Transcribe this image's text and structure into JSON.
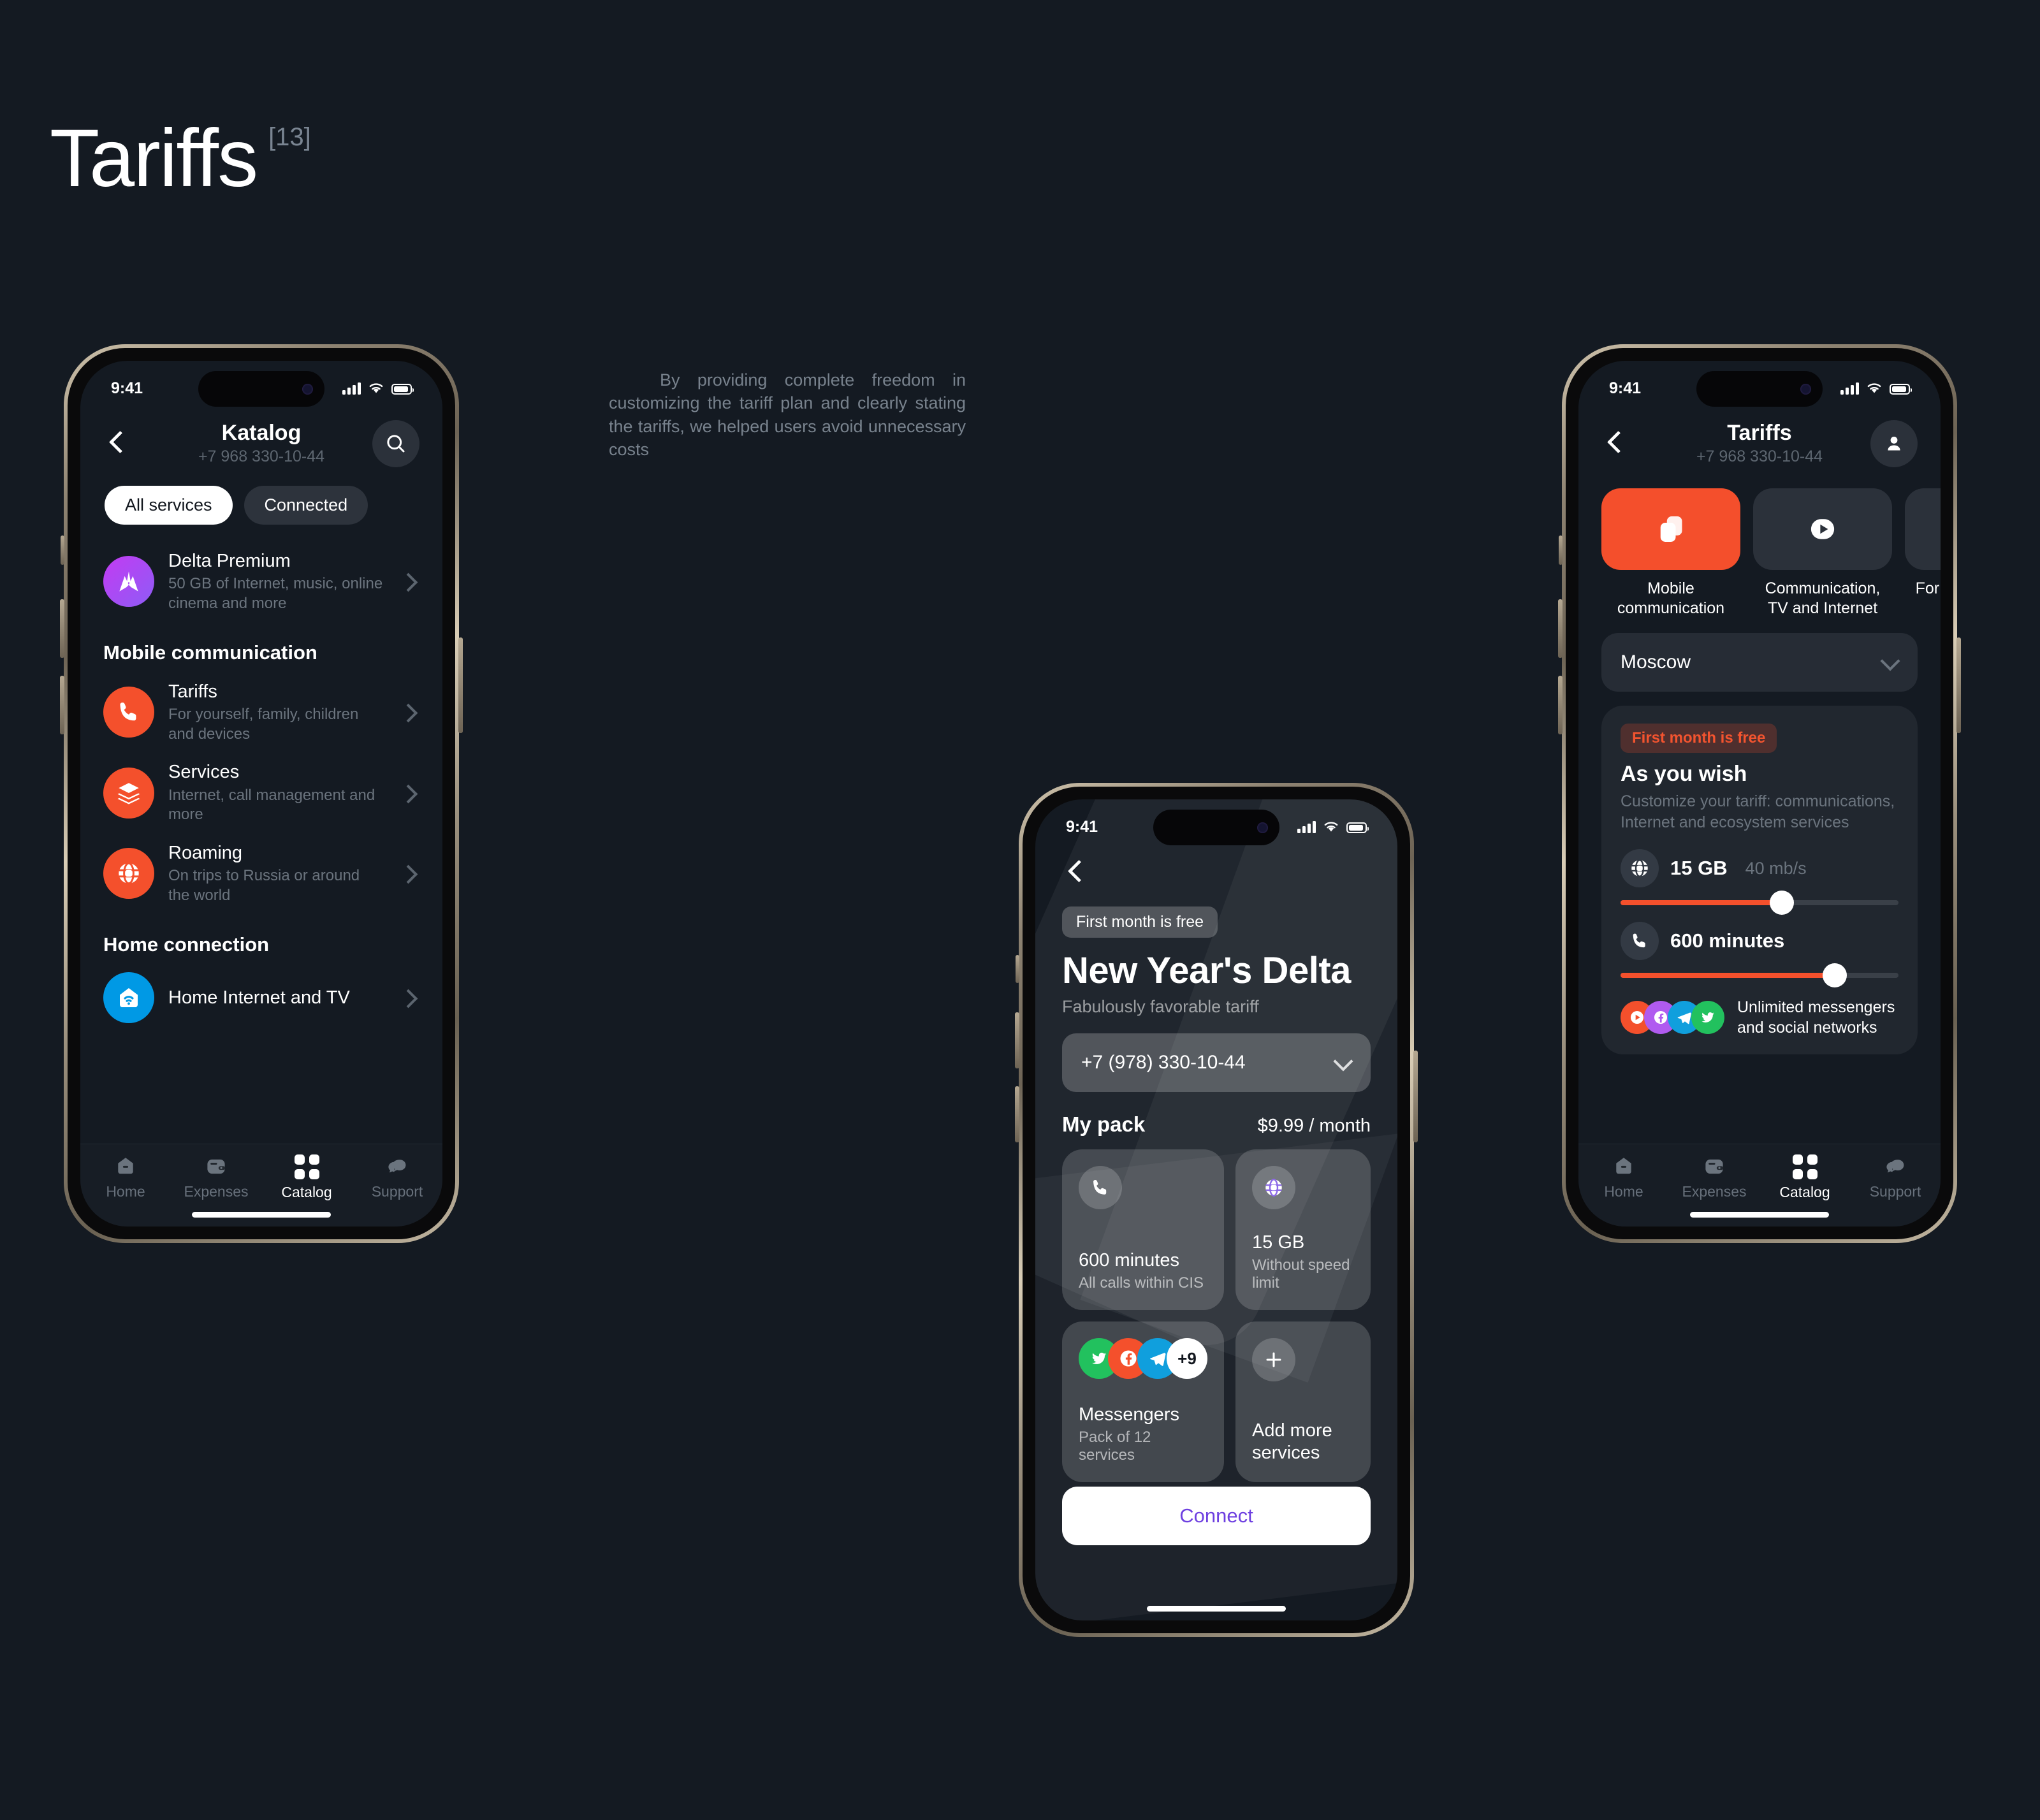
{
  "page": {
    "title": "Tariffs",
    "index": "[13]",
    "intro": "By providing complete freedom in customizing the tariff plan and clearly stating the tariffs, we helped users avoid unnecessary costs",
    "bg_color": "#141a22",
    "accent_orange": "#F4502C",
    "accent_purple": "#7945E0"
  },
  "phone_catalog": {
    "status": {
      "time": "9:41"
    },
    "nav": {
      "title": "Katalog",
      "subtitle": "+7 968 330-10-44",
      "back_icon": "chevron-left-icon",
      "action_icon": "search-icon"
    },
    "chips": [
      {
        "label": "All services",
        "selected": true
      },
      {
        "label": "Connected",
        "selected": false
      }
    ],
    "featured": {
      "title": "Delta Premium",
      "subtitle": "50 GB of Internet, music, online cinema and more",
      "icon": "delta-logo-icon",
      "icon_color": "#B83CF0"
    },
    "sections": [
      {
        "heading": "Mobile communication",
        "items": [
          {
            "title": "Tariffs",
            "subtitle": "For yourself, family, children and devices",
            "icon": "phone-icon",
            "icon_color": "#F4502C"
          },
          {
            "title": "Services",
            "subtitle": "Internet, call management and more",
            "icon": "layers-icon",
            "icon_color": "#F4502C"
          },
          {
            "title": "Roaming",
            "subtitle": "On trips to Russia or around the world",
            "icon": "globe-icon",
            "icon_color": "#F4502C"
          }
        ]
      },
      {
        "heading": "Home connection",
        "items": [
          {
            "title": "Home Internet and TV",
            "subtitle": "",
            "icon": "home-wifi-icon",
            "icon_color": "#0099E5"
          }
        ]
      }
    ],
    "tabs": [
      {
        "label": "Home",
        "icon": "home-icon",
        "active": false
      },
      {
        "label": "Expenses",
        "icon": "wallet-icon",
        "active": false
      },
      {
        "label": "Catalog",
        "icon": "grid-icon",
        "active": true
      },
      {
        "label": "Support",
        "icon": "chat-icon",
        "active": false
      }
    ]
  },
  "phone_tariff": {
    "status": {
      "time": "9:41"
    },
    "back_icon": "chevron-left-icon",
    "badge": "First month is free",
    "title": "New Year's Delta",
    "subtitle": "Fabulously favorable tariff",
    "phone_select": {
      "value": "+7 (978) 330-10-44",
      "icon": "chevron-down-icon"
    },
    "pack": {
      "heading": "My pack",
      "price": "$9.99 / month"
    },
    "cards": [
      {
        "icon": "phone-icon",
        "title": "600 minutes",
        "subtitle": "All calls within CIS"
      },
      {
        "icon": "globe-icon",
        "title": "15 GB",
        "subtitle": "Without speed limit"
      },
      {
        "icon": "messenger-stack-icon",
        "title": "Messengers",
        "subtitle": "Pack of 12 services",
        "overflow": "+9"
      },
      {
        "icon": "plus-icon",
        "title": "Add more services",
        "subtitle": ""
      }
    ],
    "cta": "Connect"
  },
  "phone_tariffs_list": {
    "status": {
      "time": "9:41"
    },
    "nav": {
      "title": "Tariffs",
      "subtitle": "+7 968 330-10-44",
      "back_icon": "chevron-left-icon",
      "action_icon": "person-icon"
    },
    "categories": [
      {
        "label": "Mobile communication",
        "icon": "sim-cards-icon",
        "selected": true
      },
      {
        "label": "Communication, TV and Internet",
        "icon": "play-icon",
        "selected": false
      },
      {
        "label": "For watch model",
        "icon": "watch-icon",
        "selected": false
      }
    ],
    "city": {
      "value": "Moscow",
      "icon": "chevron-down-icon"
    },
    "offer": {
      "badge": "First month is free",
      "title": "As you wish",
      "subtitle": "Customize your tariff: communications, Internet and ecosystem services",
      "meters": [
        {
          "icon": "globe-icon",
          "value": "15 GB",
          "unit": "40 mb/s",
          "percent": 58
        },
        {
          "icon": "phone-icon",
          "value": "600 minutes",
          "unit": "",
          "percent": 77
        }
      ],
      "messengers_text": "Unlimited messengers and social networks"
    },
    "tabs": [
      {
        "label": "Home",
        "icon": "home-icon",
        "active": false
      },
      {
        "label": "Expenses",
        "icon": "wallet-icon",
        "active": false
      },
      {
        "label": "Catalog",
        "icon": "grid-icon",
        "active": true
      },
      {
        "label": "Support",
        "icon": "chat-icon",
        "active": false
      }
    ]
  }
}
